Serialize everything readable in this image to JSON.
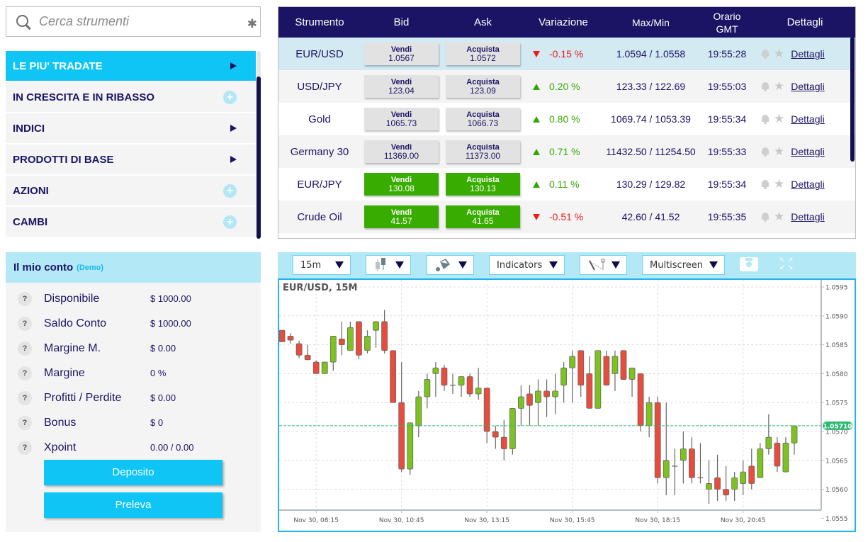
{
  "search": {
    "placeholder": "Cerca strumenti",
    "clear_icon": "asterisk-icon"
  },
  "categories": [
    {
      "label": "LE PIU' TRADATE",
      "icon": "arrow-right",
      "active": true
    },
    {
      "label": "IN CRESCITA E IN RIBASSO",
      "icon": "plus",
      "active": false
    },
    {
      "label": "INDICI",
      "icon": "arrow-right",
      "active": false
    },
    {
      "label": "PRODOTTI DI BASE",
      "icon": "arrow-right",
      "active": false
    },
    {
      "label": "AZIONI",
      "icon": "plus",
      "active": false
    },
    {
      "label": "CAMBI",
      "icon": "plus",
      "active": false
    }
  ],
  "account": {
    "title": "Il mio conto",
    "mode": "(Demo)",
    "rows": [
      {
        "label": "Disponibile",
        "value": "$ 1000.00"
      },
      {
        "label": "Saldo Conto",
        "value": "$ 1000.00"
      },
      {
        "label": "Margine M.",
        "value": "$ 0.00"
      },
      {
        "label": "Margine",
        "value": "0 %"
      },
      {
        "label": "Profitti / Perdite",
        "value": "$ 0.00"
      },
      {
        "label": "Bonus",
        "value": "$ 0"
      },
      {
        "label": "Xpoint",
        "value": "0.00 / 0.00"
      }
    ],
    "help_glyph": "?",
    "deposit_label": "Deposito",
    "withdraw_label": "Preleva"
  },
  "table": {
    "headers": {
      "instrument": "Strumento",
      "bid": "Bid",
      "ask": "Ask",
      "change": "Variazione",
      "maxmin": "Max/Min",
      "time_line1": "Orario",
      "time_line2": "GMT",
      "details": "Dettagli"
    },
    "sell_label": "Vendi",
    "buy_label": "Acquista",
    "details_link": "Dettagli",
    "rows": [
      {
        "instrument": "EUR/USD",
        "bid": "1.0567",
        "ask": "1.0572",
        "change": "-0.15 %",
        "direction": "down",
        "maxmin": "1.0594 / 1.0558",
        "time": "19:55:28",
        "highlight": false,
        "selected": true
      },
      {
        "instrument": "USD/JPY",
        "bid": "123.04",
        "ask": "123.09",
        "change": "0.20 %",
        "direction": "up",
        "maxmin": "123.33 / 122.69",
        "time": "19:55:03",
        "highlight": false,
        "selected": false
      },
      {
        "instrument": "Gold",
        "bid": "1065.73",
        "ask": "1066.73",
        "change": "0.80 %",
        "direction": "up",
        "maxmin": "1069.74 / 1053.39",
        "time": "19:55:34",
        "highlight": false,
        "selected": false
      },
      {
        "instrument": "Germany 30",
        "bid": "11369.00",
        "ask": "11373.00",
        "change": "0.71 %",
        "direction": "up",
        "maxmin": "11432.50 / 11254.50",
        "time": "19:55:33",
        "highlight": false,
        "selected": false
      },
      {
        "instrument": "EUR/JPY",
        "bid": "130.08",
        "ask": "130.13",
        "change": "0.11 %",
        "direction": "up",
        "maxmin": "130.29 / 129.82",
        "time": "19:55:34",
        "highlight": true,
        "selected": false
      },
      {
        "instrument": "Crude Oil",
        "bid": "41.57",
        "ask": "41.65",
        "change": "-0.51 %",
        "direction": "down",
        "maxmin": "42.60 / 41.52",
        "time": "19:55:35",
        "highlight": true,
        "selected": false
      }
    ]
  },
  "toolbar": {
    "interval": "15m",
    "chart_type_icon": "candlestick-icon",
    "style_icon": "paint-bucket-icon",
    "indicators": "Indicators",
    "drawing_icon": "drawing-tools-icon",
    "multiscreen": "Multiscreen",
    "screenshot_icon": "camera-icon",
    "fullscreen_icon": "fullscreen-icon"
  },
  "colors": {
    "up": "#7dc21e",
    "down": "#e84c3d",
    "accent": "#0ec5f5",
    "header": "#1b1464",
    "last_price": "#2dba73"
  },
  "chart_data": {
    "type": "candlestick",
    "title": "EUR/USD, 15M",
    "ylim": [
      1.0555,
      1.0596
    ],
    "yticks": [
      "1.0595",
      "1.0590",
      "1.0585",
      "1.0580",
      "1.0575",
      "1.0570",
      "1.0565",
      "1.0560",
      "1.0555"
    ],
    "xticks": [
      "Nov 30, 08:15",
      "Nov 30, 10:45",
      "Nov 30, 13:15",
      "Nov 30, 15:45",
      "Nov 30, 18:15",
      "Nov 30, 20:45"
    ],
    "xtick_candle_index": [
      4,
      14,
      24,
      34,
      44,
      54
    ],
    "last_price": "1.05710",
    "last_price_value": 1.0571,
    "grid": true,
    "candles": [
      {
        "o": 1.05875,
        "h": 1.05875,
        "l": 1.05855,
        "c": 1.05855
      },
      {
        "o": 1.05865,
        "h": 1.0587,
        "l": 1.05852,
        "c": 1.05858
      },
      {
        "o": 1.05852,
        "h": 1.05857,
        "l": 1.05827,
        "c": 1.05832
      },
      {
        "o": 1.05832,
        "h": 1.0585,
        "l": 1.05824,
        "c": 1.05824
      },
      {
        "o": 1.0582,
        "h": 1.05823,
        "l": 1.058,
        "c": 1.058
      },
      {
        "o": 1.058,
        "h": 1.0582,
        "l": 1.058,
        "c": 1.0582
      },
      {
        "o": 1.0582,
        "h": 1.05865,
        "l": 1.05805,
        "c": 1.05865
      },
      {
        "o": 1.0586,
        "h": 1.0589,
        "l": 1.05832,
        "c": 1.0585
      },
      {
        "o": 1.0584,
        "h": 1.0589,
        "l": 1.0584,
        "c": 1.0588
      },
      {
        "o": 1.0589,
        "h": 1.0589,
        "l": 1.05825,
        "c": 1.05832
      },
      {
        "o": 1.0584,
        "h": 1.05875,
        "l": 1.05835,
        "c": 1.05865
      },
      {
        "o": 1.05875,
        "h": 1.0589,
        "l": 1.05845,
        "c": 1.0589
      },
      {
        "o": 1.0589,
        "h": 1.0591,
        "l": 1.05835,
        "c": 1.0584
      },
      {
        "o": 1.0584,
        "h": 1.0582,
        "l": 1.0576,
        "c": 1.0575
      },
      {
        "o": 1.0575,
        "h": 1.0582,
        "l": 1.0563,
        "c": 1.05635
      },
      {
        "o": 1.05635,
        "h": 1.05715,
        "l": 1.05625,
        "c": 1.05715
      },
      {
        "o": 1.0571,
        "h": 1.0577,
        "l": 1.0569,
        "c": 1.0576
      },
      {
        "o": 1.0576,
        "h": 1.058,
        "l": 1.0574,
        "c": 1.0579
      },
      {
        "o": 1.058,
        "h": 1.0582,
        "l": 1.0576,
        "c": 1.0581
      },
      {
        "o": 1.0581,
        "h": 1.05815,
        "l": 1.0577,
        "c": 1.0578
      },
      {
        "o": 1.0578,
        "h": 1.058,
        "l": 1.05765,
        "c": 1.0578
      },
      {
        "o": 1.0578,
        "h": 1.05785,
        "l": 1.0576,
        "c": 1.05795
      },
      {
        "o": 1.05795,
        "h": 1.058,
        "l": 1.0576,
        "c": 1.05765
      },
      {
        "o": 1.05765,
        "h": 1.0581,
        "l": 1.05755,
        "c": 1.05775
      },
      {
        "o": 1.05775,
        "h": 1.05775,
        "l": 1.0568,
        "c": 1.057
      },
      {
        "o": 1.057,
        "h": 1.0571,
        "l": 1.0567,
        "c": 1.0569
      },
      {
        "o": 1.0569,
        "h": 1.0572,
        "l": 1.0565,
        "c": 1.0567
      },
      {
        "o": 1.0567,
        "h": 1.0571,
        "l": 1.0566,
        "c": 1.0574
      },
      {
        "o": 1.0574,
        "h": 1.0578,
        "l": 1.0571,
        "c": 1.0576
      },
      {
        "o": 1.05765,
        "h": 1.0578,
        "l": 1.0571,
        "c": 1.05745
      },
      {
        "o": 1.0575,
        "h": 1.0579,
        "l": 1.0571,
        "c": 1.0577
      },
      {
        "o": 1.0577,
        "h": 1.0579,
        "l": 1.05725,
        "c": 1.0576
      },
      {
        "o": 1.0576,
        "h": 1.058,
        "l": 1.0573,
        "c": 1.0577
      },
      {
        "o": 1.0578,
        "h": 1.0582,
        "l": 1.0575,
        "c": 1.0581
      },
      {
        "o": 1.0581,
        "h": 1.0584,
        "l": 1.0575,
        "c": 1.0583
      },
      {
        "o": 1.0584,
        "h": 1.0584,
        "l": 1.0576,
        "c": 1.0578
      },
      {
        "o": 1.058,
        "h": 1.0583,
        "l": 1.05745,
        "c": 1.0574
      },
      {
        "o": 1.0574,
        "h": 1.0584,
        "l": 1.0574,
        "c": 1.0584
      },
      {
        "o": 1.0583,
        "h": 1.0584,
        "l": 1.0578,
        "c": 1.0578
      },
      {
        "o": 1.058,
        "h": 1.0584,
        "l": 1.0577,
        "c": 1.0583
      },
      {
        "o": 1.0584,
        "h": 1.0584,
        "l": 1.05795,
        "c": 1.0579
      },
      {
        "o": 1.0579,
        "h": 1.0579,
        "l": 1.0576,
        "c": 1.0581
      },
      {
        "o": 1.058,
        "h": 1.058,
        "l": 1.057,
        "c": 1.0571
      },
      {
        "o": 1.0571,
        "h": 1.0576,
        "l": 1.0569,
        "c": 1.0575
      },
      {
        "o": 1.0575,
        "h": 1.0576,
        "l": 1.0561,
        "c": 1.0562
      },
      {
        "o": 1.0562,
        "h": 1.0575,
        "l": 1.0559,
        "c": 1.0565
      },
      {
        "o": 1.0564,
        "h": 1.0567,
        "l": 1.0559,
        "c": 1.0564
      },
      {
        "o": 1.0565,
        "h": 1.057,
        "l": 1.0561,
        "c": 1.0567
      },
      {
        "o": 1.0567,
        "h": 1.0569,
        "l": 1.0561,
        "c": 1.0562
      },
      {
        "o": 1.0562,
        "h": 1.0568,
        "l": 1.0561,
        "c": 1.0562
      },
      {
        "o": 1.056,
        "h": 1.0565,
        "l": 1.05575,
        "c": 1.0561
      },
      {
        "o": 1.0562,
        "h": 1.0566,
        "l": 1.0558,
        "c": 1.056
      },
      {
        "o": 1.056,
        "h": 1.0564,
        "l": 1.0558,
        "c": 1.0559
      },
      {
        "o": 1.056,
        "h": 1.0563,
        "l": 1.0558,
        "c": 1.0562
      },
      {
        "o": 1.0561,
        "h": 1.0565,
        "l": 1.0559,
        "c": 1.0563
      },
      {
        "o": 1.0564,
        "h": 1.0567,
        "l": 1.056,
        "c": 1.0561
      },
      {
        "o": 1.0562,
        "h": 1.0568,
        "l": 1.0562,
        "c": 1.0567
      },
      {
        "o": 1.0567,
        "h": 1.0573,
        "l": 1.0566,
        "c": 1.0569
      },
      {
        "o": 1.0568,
        "h": 1.0569,
        "l": 1.0563,
        "c": 1.0564
      },
      {
        "o": 1.0563,
        "h": 1.0569,
        "l": 1.0563,
        "c": 1.0568
      },
      {
        "o": 1.0568,
        "h": 1.0571,
        "l": 1.0566,
        "c": 1.0571
      }
    ]
  }
}
